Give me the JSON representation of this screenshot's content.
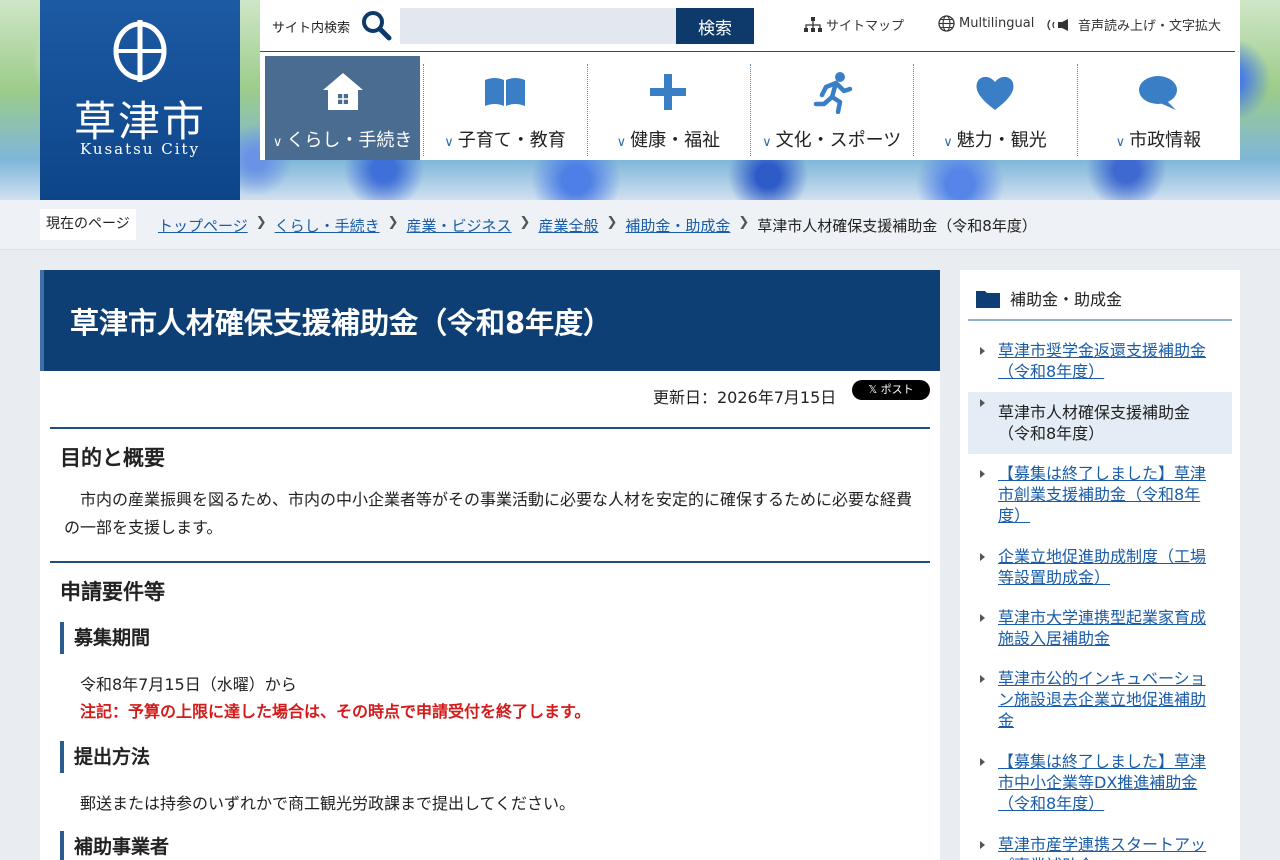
{
  "logo": {
    "name": "草津市",
    "sub": "Kusatsu City"
  },
  "header": {
    "search_label": "サイト内検索",
    "search_placeholder": "",
    "search_button": "検索",
    "sitemap": "サイトマップ",
    "multilingual": "Multilingual",
    "accessibility": "音声読み上げ・文字拡大"
  },
  "nav": [
    {
      "label": "くらし・手続き",
      "icon": "house-icon",
      "active": true
    },
    {
      "label": "子育て・教育",
      "icon": "book-icon"
    },
    {
      "label": "健康・福祉",
      "icon": "plus-icon"
    },
    {
      "label": "文化・スポーツ",
      "icon": "runner-icon"
    },
    {
      "label": "魅力・観光",
      "icon": "heart-icon"
    },
    {
      "label": "市政情報",
      "icon": "speech-bubble-icon"
    }
  ],
  "breadcrumb": {
    "label": "現在のページ",
    "items": [
      "トップページ",
      "くらし・手続き",
      "産業・ビジネス",
      "産業全般",
      "補助金・助成金"
    ],
    "current": "草津市人材確保支援補助金（令和8年度）"
  },
  "article": {
    "title": "草津市人材確保支援補助金（令和8年度）",
    "updated": "更新日：2026年7月15日",
    "share": "ポスト",
    "section1": {
      "heading": "目的と概要",
      "text": "市内の産業振興を図るため、市内の中小企業者等がその事業活動に必要な人材を安定的に確保するために必要な経費の一部を支援します。"
    },
    "section2": {
      "heading": "申請要件等",
      "sub1": {
        "heading": "募集期間",
        "text": "令和8年7月15日（水曜）から",
        "note": "注記：予算の上限に達した場合は、その時点で申請受付を終了します。"
      },
      "sub2": {
        "heading": "提出方法",
        "text": "郵送または持参のいずれかで商工観光労政課まで提出してください。"
      },
      "sub3": {
        "heading": "補助事業者"
      }
    }
  },
  "sidebar": {
    "heading": "補助金・助成金",
    "items": [
      {
        "label": "草津市奨学金返還支援補助金（令和8年度）"
      },
      {
        "label": "草津市人材確保支援補助金（令和8年度）",
        "current": true
      },
      {
        "label": "【募集は終了しました】草津市創業支援補助金（令和8年度）"
      },
      {
        "label": "企業立地促進助成制度（工場等設置助成金）"
      },
      {
        "label": "草津市大学連携型起業家育成施設入居補助金"
      },
      {
        "label": "草津市公的インキュベーション施設退去企業立地促進補助金"
      },
      {
        "label": "【募集は終了しました】草津市中小企業等DX推進補助金（令和8年度）"
      },
      {
        "label": "草津市産学連携スタートアップ事業補助金"
      }
    ]
  },
  "colors": {
    "brand": "#0d3f74",
    "link": "#1a5ca8",
    "note": "#d41a1a",
    "nav_active": "#4a6c91"
  }
}
